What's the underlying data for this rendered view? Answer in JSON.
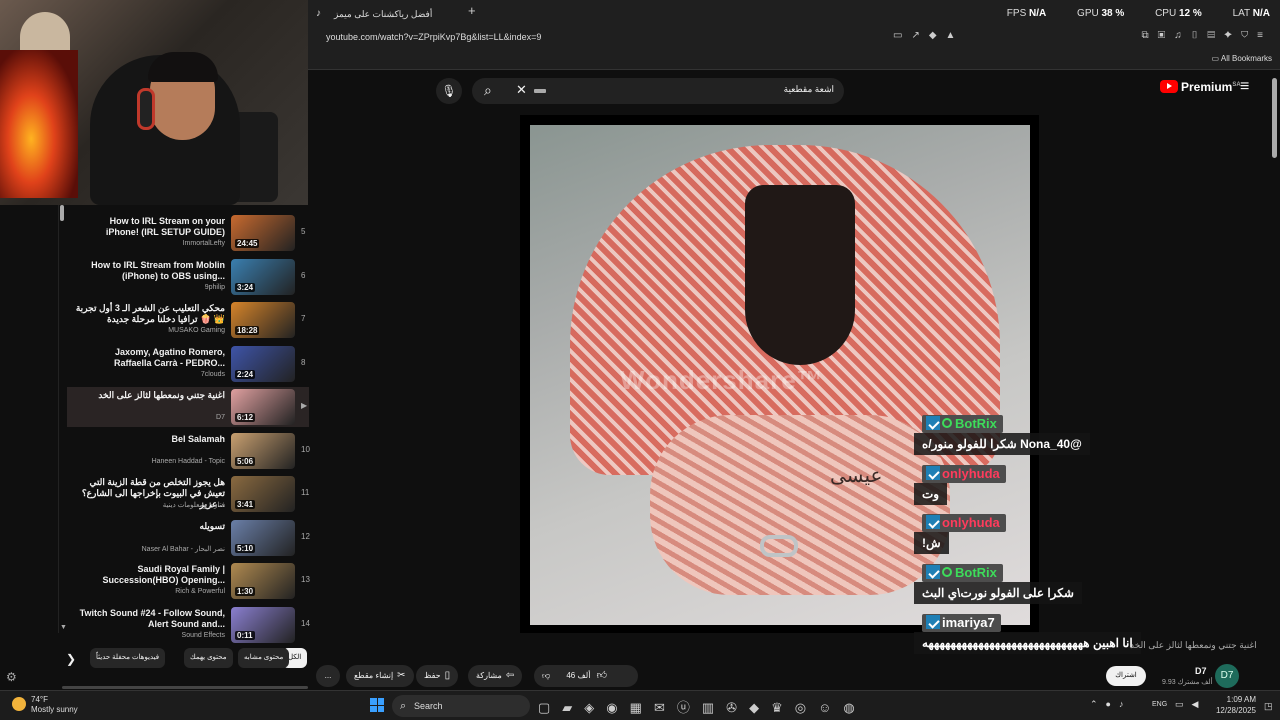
{
  "browser": {
    "tab_title": "أفضل رياكشنات على ميمز كوكسال بابا",
    "new_tab_symbol": "+",
    "url": "youtube.com/watch?v=ZPrpiKvp7Bg&list=LL&index=9",
    "bookmarks_label": "All Bookmarks",
    "stats": {
      "fps_label": "FPS",
      "fps_value": "N/A",
      "gpu_label": "GPU",
      "gpu_value": "38 %",
      "cpu_label": "CPU",
      "cpu_value": "12 %",
      "lat_label": "LAT",
      "lat_value": "N/A"
    }
  },
  "youtube": {
    "search_query": "اشعة مقطعية",
    "logo_text": "Premium",
    "logo_region": "SA"
  },
  "playlist": {
    "items": [
      {
        "index": "5",
        "title": "How to IRL Stream on your iPhone! (IRL SETUP GUIDE)",
        "channel": "ImmortalLefty",
        "duration": "24:45",
        "thumb_color": "#c86a2f"
      },
      {
        "index": "6",
        "title": "How to IRL Stream from Moblin (iPhone) to OBS using...",
        "channel": "9philip",
        "duration": "3:24",
        "thumb_color": "#3a7fb0"
      },
      {
        "index": "7",
        "title": "محكي التعليب عن الشعر الـ 3 أول تجربة ترافيا دخلنا مرحلة جديدة 🍿 👑",
        "channel": "MUSAKO Gaming",
        "duration": "18:28",
        "thumb_color": "#d6842a"
      },
      {
        "index": "8",
        "title": "Jaxomy, Agatino Romero, Raffaella Carrà - PEDRO...",
        "channel": "7clouds",
        "duration": "2:24",
        "thumb_color": "#3e54a8"
      },
      {
        "index": "▶",
        "title": "اغنية جتني ونمعطها لثالز على الخد",
        "channel": "D7",
        "duration": "6:12",
        "thumb_color": "#e0a0a0"
      },
      {
        "index": "10",
        "title": "Bel Salamah",
        "channel": "Haneen Haddad - Topic",
        "duration": "5:06",
        "thumb_color": "#c9a070"
      },
      {
        "index": "11",
        "title": "هل يجوز التخلص من قطة الزينة التي تعيش في البيوت بإخراجها الى الشارع؟ عزيز...",
        "channel": "فتاوى ومعلومات دينية",
        "duration": "3:41",
        "thumb_color": "#8a6a40"
      },
      {
        "index": "12",
        "title": "تسويله",
        "channel": "Naser Al Bahar - نصر البحار",
        "duration": "5:10",
        "thumb_color": "#6a7fa8"
      },
      {
        "index": "13",
        "title": "Saudi Royal Family | Succession(HBO) Opening...",
        "channel": "Rich & Powerful",
        "duration": "1:30",
        "thumb_color": "#b08a50"
      },
      {
        "index": "14",
        "title": "Twitch Sound #24 - Follow Sound, Alert Sound and...",
        "channel": "Sound Effects",
        "duration": "0:11",
        "thumb_color": "#8a7fd0"
      }
    ],
    "chips": [
      "الكل",
      "محتوى مشابه",
      "محتوى يهمك",
      "فيديوهات محفلة حديثاً"
    ]
  },
  "chat": {
    "messages": [
      {
        "user": "BotRix",
        "user_color": "#3ddc5a",
        "mod": true,
        "text": "@Nona_40 شكرا للفولو منور/ه"
      },
      {
        "user": "onlyhuda",
        "user_color": "#ff3b5c",
        "mod": false,
        "text": "وت"
      },
      {
        "user": "onlyhuda",
        "user_color": "#ff3b5c",
        "mod": false,
        "text": "ش!"
      },
      {
        "user": "BotRix",
        "user_color": "#3ddc5a",
        "mod": true,
        "text": "شكرا على الفولو نورت\\ي البث"
      },
      {
        "user": "imariya7",
        "user_color": "#ffffff",
        "mod": false,
        "text": "انا اهبين هههههههههههههههههههههههههههههه"
      }
    ]
  },
  "video": {
    "watermark": "Wondershare™",
    "signature": "عيسى",
    "title": "اغنية جتني ونمعطها لثالز على الخد",
    "channel_name": "D7",
    "channel_initials": "D7",
    "channel_subs": "9.93 ألف مشترك",
    "subscribe_label": "اشتراك",
    "actions": {
      "like_count": "46 ألف",
      "share": "مشاركة",
      "save": "حفظ",
      "clip": "إنشاء مقطع",
      "more": "..."
    }
  },
  "taskbar": {
    "temp": "74°F",
    "condition": "Mostly sunny",
    "search_label": "Search",
    "lang": "ENG",
    "time": "1:09 AM",
    "date": "12/28/2025"
  }
}
